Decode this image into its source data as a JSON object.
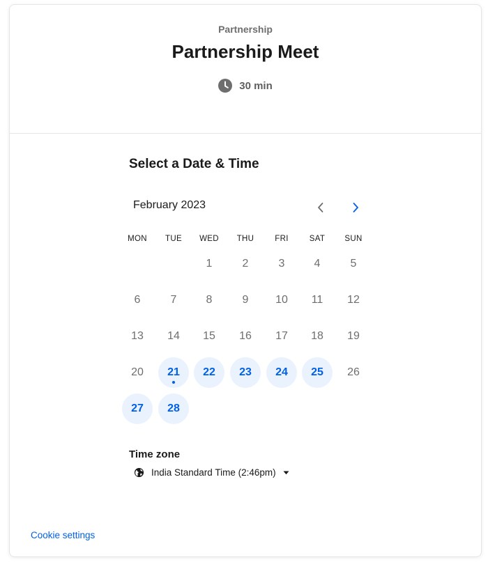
{
  "header": {
    "org_name": "Partnership",
    "event_title": "Partnership Meet",
    "duration": "30 min",
    "duration_icon": "clock-icon"
  },
  "calendar": {
    "section_title": "Select a Date & Time",
    "month_label": "February 2023",
    "prev_icon": "chevron-left-icon",
    "next_icon": "chevron-right-icon",
    "weekdays": [
      "MON",
      "TUE",
      "WED",
      "THU",
      "FRI",
      "SAT",
      "SUN"
    ],
    "days": [
      {
        "label": "1",
        "available": false
      },
      {
        "label": "2",
        "available": false
      },
      {
        "label": "3",
        "available": false
      },
      {
        "label": "4",
        "available": false
      },
      {
        "label": "5",
        "available": false
      },
      {
        "label": "6",
        "available": false
      },
      {
        "label": "7",
        "available": false
      },
      {
        "label": "8",
        "available": false
      },
      {
        "label": "9",
        "available": false
      },
      {
        "label": "10",
        "available": false
      },
      {
        "label": "11",
        "available": false
      },
      {
        "label": "12",
        "available": false
      },
      {
        "label": "13",
        "available": false
      },
      {
        "label": "14",
        "available": false
      },
      {
        "label": "15",
        "available": false
      },
      {
        "label": "16",
        "available": false
      },
      {
        "label": "17",
        "available": false
      },
      {
        "label": "18",
        "available": false
      },
      {
        "label": "19",
        "available": false
      },
      {
        "label": "20",
        "available": false
      },
      {
        "label": "21",
        "available": true,
        "today": true
      },
      {
        "label": "22",
        "available": true
      },
      {
        "label": "23",
        "available": true
      },
      {
        "label": "24",
        "available": true
      },
      {
        "label": "25",
        "available": true
      },
      {
        "label": "26",
        "available": false
      },
      {
        "label": "27",
        "available": true
      },
      {
        "label": "28",
        "available": true
      }
    ]
  },
  "timezone": {
    "title": "Time zone",
    "value": "India Standard Time (2:46pm)",
    "icon": "globe-icon"
  },
  "footer": {
    "cookie_label": "Cookie settings"
  },
  "colors": {
    "accent": "#0060e6",
    "available_bg": "#eaf2fe",
    "muted_text": "#6e6e6e",
    "border": "#e4e6e8"
  }
}
